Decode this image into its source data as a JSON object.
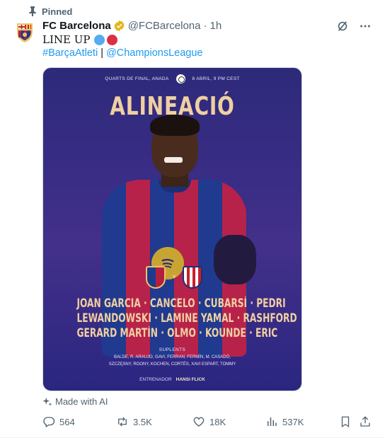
{
  "pinned": {
    "label": "Pinned"
  },
  "author": {
    "name": "FC Barcelona",
    "handle": "@FCBarcelona",
    "separator": "·",
    "time": "1h"
  },
  "tweet": {
    "text": "LINE UP",
    "hashtag1": "#BarçaAtleti",
    "divider": "|",
    "mention": "@ChampionsLeague"
  },
  "media": {
    "top_left": "QUARTS DE FINAL, ANADA",
    "top_right": "8 ABRIL, 9 PM CEST",
    "title": "ALINEACIÓ",
    "lineup": [
      "JOAN GARCIA · CANCELO · CUBARSÍ · PEDRI",
      "LEWANDOWSKI · LAMINE YAMAL · RASHFORD",
      "GERARD MARTÍN · OLMO · KOUNDE · ERIC"
    ],
    "subs_label": "SUPLENTS",
    "subs": [
      "BALDE, R. ARAUJO, GAVI, FERRAN, FERMÍN, M. CASADÓ,",
      "SZCZĘSNY, ROONY, KOCHEN, CORTÉS, XAVI ESPART, TOMMY"
    ],
    "coach_label": "ENTRENADOR",
    "coach_name": "HANSI FLICK",
    "crest_vs": "V"
  },
  "made_with_ai": "Made with AI",
  "stats": {
    "replies": "564",
    "reposts": "3.5K",
    "likes": "18K",
    "views": "537K"
  },
  "colors": {
    "accent": "#1d9bf0",
    "muted": "#536471",
    "verified": "#e2b719",
    "poster_text": "#f0cfa1"
  },
  "icons": [
    "pin-icon",
    "verified-badge-icon",
    "grok-icon",
    "more-icon",
    "sparkle-icon",
    "reply-icon",
    "repost-icon",
    "like-icon",
    "views-icon",
    "bookmark-icon",
    "share-icon"
  ]
}
